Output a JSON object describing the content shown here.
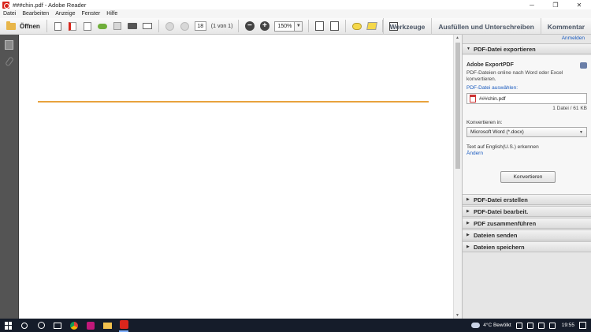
{
  "window": {
    "title": "###chin.pdf - Adobe Reader",
    "controls": {
      "minimize": "─",
      "restore": "❐",
      "close": "✕"
    }
  },
  "menu": [
    "Datei",
    "Bearbeiten",
    "Anzeige",
    "Fenster",
    "Hilfe"
  ],
  "toolbar": {
    "open_label": "Öffnen",
    "page_number": "18",
    "page_of": "(1 von 1)",
    "zoom_value": "150%",
    "links": [
      "Werkzeuge",
      "Ausfüllen und Unterschreiben",
      "Kommentar"
    ]
  },
  "right_panel": {
    "signin_label": "Anmelden",
    "export_section_title": "PDF-Datei exportieren",
    "export_heading": "Adobe ExportPDF",
    "export_description": "PDF-Dateien online nach Word oder Excel konvertieren.",
    "select_file_label": "PDF-Datei auswählen:",
    "file_name": "###chin.pdf",
    "file_count": "1 Datei / 61 KB",
    "convert_to_label": "Konvertieren in:",
    "convert_format": "Microsoft Word (*.docx)",
    "ocr_label": "Text auf English(U.S.) erkennen",
    "change_link": "Ändern",
    "convert_button": "Konvertieren",
    "sections": [
      "PDF-Datei erstellen",
      "PDF-Datei bearbeit.",
      "PDF zusammenführen",
      "Dateien senden",
      "Dateien speichern"
    ]
  },
  "taskbar": {
    "weather": "4°C  Bewölkt",
    "time": "19:55"
  },
  "colors": {
    "doc_line": "#e8a33d",
    "link_blue": "#1a5bbf",
    "taskbar": "#151c2a"
  }
}
